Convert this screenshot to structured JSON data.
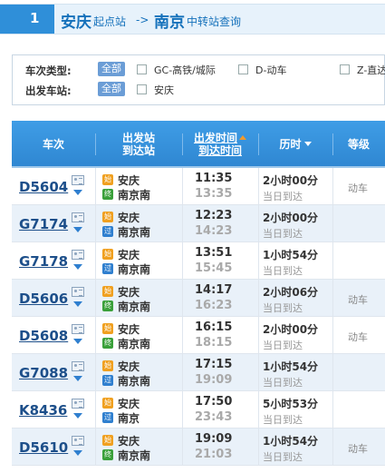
{
  "header": {
    "step": "1",
    "from_city": "安庆",
    "from_suffix": "起点站",
    "arrow": "->",
    "to_city": "南京",
    "to_suffix": "中转站查询"
  },
  "filters": {
    "train_type_label": "车次类型:",
    "train_type_all": "全部",
    "options": [
      "GC-高铁/城际",
      "D-动车",
      "Z-直达"
    ],
    "station_label": "出发车站:",
    "station_all": "全部",
    "stations": [
      "安庆"
    ]
  },
  "table": {
    "headers": {
      "train": "车次",
      "stations_top": "出发站",
      "stations_bottom": "到达站",
      "time_top": "出发时间",
      "time_bottom": "到达时间",
      "duration": "历时",
      "grade": "等级"
    },
    "badges": {
      "start": "始",
      "end": "终",
      "pass": "过"
    },
    "rows": [
      {
        "train": "D5604",
        "from": "安庆",
        "to": "南京南",
        "to_type": "end",
        "dep": "11:35",
        "arr": "13:35",
        "duration": "2小时00分",
        "arrival": "当日到达",
        "grade": "动车"
      },
      {
        "train": "G7174",
        "from": "安庆",
        "to": "南京南",
        "to_type": "pass",
        "dep": "12:23",
        "arr": "14:23",
        "duration": "2小时00分",
        "arrival": "当日到达",
        "grade": ""
      },
      {
        "train": "G7178",
        "from": "安庆",
        "to": "南京南",
        "to_type": "pass",
        "dep": "13:51",
        "arr": "15:45",
        "duration": "1小时54分",
        "arrival": "当日到达",
        "grade": ""
      },
      {
        "train": "D5606",
        "from": "安庆",
        "to": "南京南",
        "to_type": "end",
        "dep": "14:17",
        "arr": "16:23",
        "duration": "2小时06分",
        "arrival": "当日到达",
        "grade": "动车"
      },
      {
        "train": "D5608",
        "from": "安庆",
        "to": "南京南",
        "to_type": "end",
        "dep": "16:15",
        "arr": "18:15",
        "duration": "2小时00分",
        "arrival": "当日到达",
        "grade": "动车"
      },
      {
        "train": "G7088",
        "from": "安庆",
        "to": "南京南",
        "to_type": "pass",
        "dep": "17:15",
        "arr": "19:09",
        "duration": "1小时54分",
        "arrival": "当日到达",
        "grade": ""
      },
      {
        "train": "K8436",
        "from": "安庆",
        "to": "南京",
        "to_type": "pass",
        "dep": "17:50",
        "arr": "23:43",
        "duration": "5小时53分",
        "arrival": "当日到达",
        "grade": ""
      },
      {
        "train": "D5610",
        "from": "安庆",
        "to": "南京南",
        "to_type": "end",
        "dep": "19:09",
        "arr": "21:03",
        "duration": "1小时54分",
        "arrival": "当日到达",
        "grade": "动车"
      }
    ]
  }
}
